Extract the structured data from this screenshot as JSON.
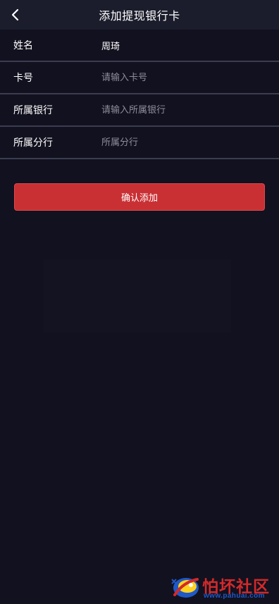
{
  "header": {
    "title": "添加提现银行卡",
    "back_icon": "chevron-left-icon"
  },
  "form": {
    "name": {
      "label": "姓名",
      "value": "周琦"
    },
    "card_number": {
      "label": "卡号",
      "placeholder": "请输入卡号"
    },
    "bank": {
      "label": "所属银行",
      "placeholder": "请输入所属银行"
    },
    "branch": {
      "label": "所属分行",
      "placeholder": "所属分行"
    }
  },
  "submit": {
    "label": "确认添加"
  },
  "watermark": {
    "brand": "怕坏社区",
    "url": "www.pahuai.com"
  },
  "colors": {
    "background": "#12111f",
    "header": "#1b1d2c",
    "divider": "#3b3c4f",
    "button": "#c93034",
    "brand_red": "#d12a2a",
    "brand_blue": "#1f59c7"
  }
}
